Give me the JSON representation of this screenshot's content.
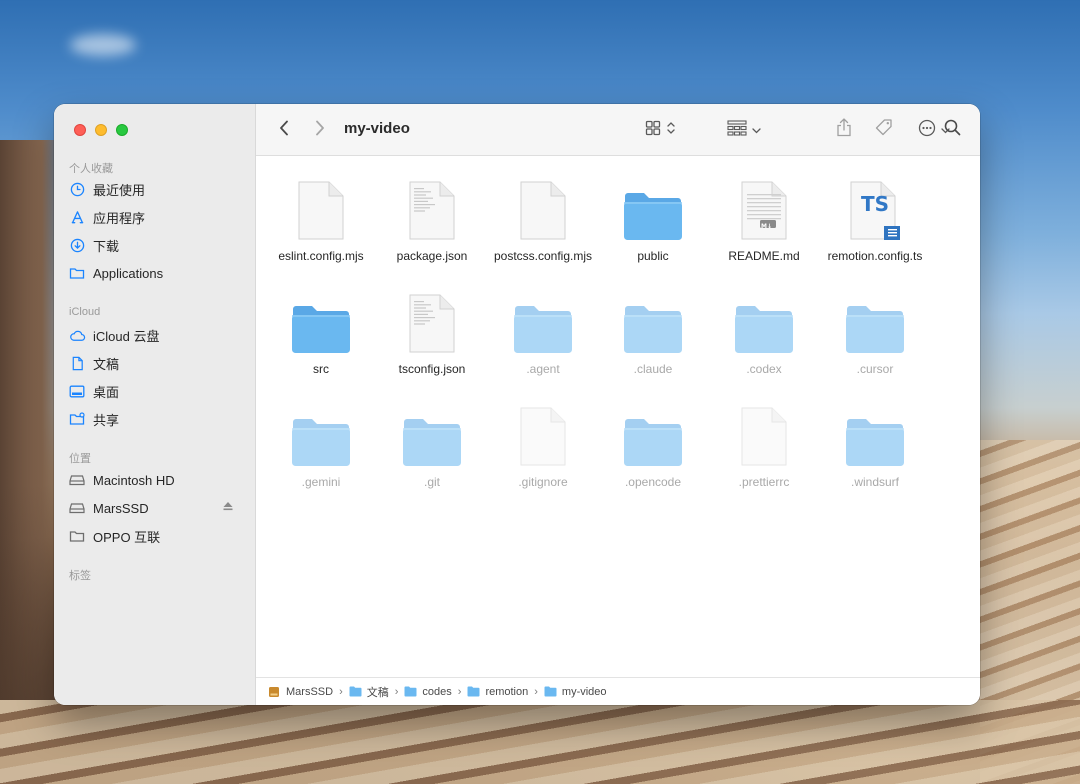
{
  "window": {
    "title": "my-video"
  },
  "sidebar": {
    "sections": [
      {
        "title": "个人收藏",
        "items": [
          {
            "label": "最近使用",
            "icon": "clock-icon"
          },
          {
            "label": "应用程序",
            "icon": "apps-icon"
          },
          {
            "label": "下载",
            "icon": "download-icon"
          },
          {
            "label": "Applications",
            "icon": "folder-icon"
          }
        ]
      },
      {
        "title": "iCloud",
        "items": [
          {
            "label": "iCloud 云盘",
            "icon": "cloud-icon"
          },
          {
            "label": "文稿",
            "icon": "document-icon"
          },
          {
            "label": "桌面",
            "icon": "desktop-icon"
          },
          {
            "label": "共享",
            "icon": "shared-folder-icon"
          }
        ]
      },
      {
        "title": "位置",
        "items": [
          {
            "label": "Macintosh HD",
            "icon": "drive-icon"
          },
          {
            "label": "MarsSSD",
            "icon": "drive-icon"
          },
          {
            "label": "OPPO 互联",
            "icon": "folder-icon"
          }
        ]
      },
      {
        "title": "标签",
        "items": []
      }
    ]
  },
  "files": [
    {
      "name": "eslint.config.mjs",
      "kind": "document",
      "hidden": false
    },
    {
      "name": "package.json",
      "kind": "document-lines",
      "hidden": false
    },
    {
      "name": "postcss.config.mjs",
      "kind": "document",
      "hidden": false
    },
    {
      "name": "public",
      "kind": "folder",
      "hidden": false
    },
    {
      "name": "README.md",
      "kind": "markdown",
      "hidden": false
    },
    {
      "name": "remotion.config.ts",
      "kind": "typescript",
      "hidden": false
    },
    {
      "name": "src",
      "kind": "folder",
      "hidden": false
    },
    {
      "name": "tsconfig.json",
      "kind": "document-lines",
      "hidden": false
    },
    {
      "name": ".agent",
      "kind": "folder",
      "hidden": true
    },
    {
      "name": ".claude",
      "kind": "folder",
      "hidden": true
    },
    {
      "name": ".codex",
      "kind": "folder",
      "hidden": true
    },
    {
      "name": ".cursor",
      "kind": "folder",
      "hidden": true
    },
    {
      "name": ".gemini",
      "kind": "folder",
      "hidden": true
    },
    {
      "name": ".git",
      "kind": "folder",
      "hidden": true
    },
    {
      "name": ".gitignore",
      "kind": "document",
      "hidden": true
    },
    {
      "name": ".opencode",
      "kind": "folder",
      "hidden": true
    },
    {
      "name": ".prettierrc",
      "kind": "document",
      "hidden": true
    },
    {
      "name": ".windsurf",
      "kind": "folder",
      "hidden": true
    }
  ],
  "icon_text": {
    "ts": "TS",
    "md": "M↓"
  },
  "pathbar": [
    {
      "label": "MarsSSD",
      "icon": "drive-icon"
    },
    {
      "label": "文稿",
      "icon": "folder-icon"
    },
    {
      "label": "codes",
      "icon": "folder-icon"
    },
    {
      "label": "remotion",
      "icon": "folder-icon"
    },
    {
      "label": "my-video",
      "icon": "folder-icon"
    }
  ],
  "pathbar_separator": "›",
  "colors": {
    "folder": "#6ab8f0",
    "folder_tab": "#5aa8e6",
    "accent": "#1a84ff",
    "close": "#fe5f57",
    "minimize": "#febc2e",
    "maximize": "#28c840"
  }
}
